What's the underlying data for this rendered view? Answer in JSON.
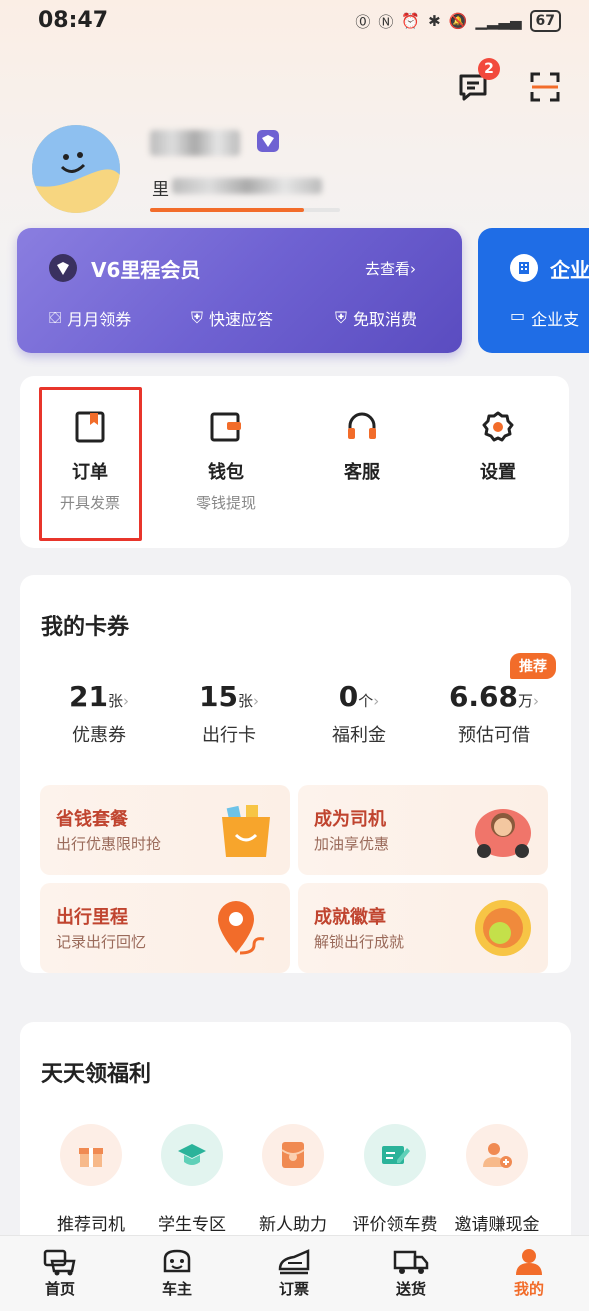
{
  "status_bar": {
    "time": "08:47",
    "battery": "67"
  },
  "header": {
    "message_badge": "2"
  },
  "profile": {
    "mileage_prefix": "里"
  },
  "vip": {
    "title": "V6里程会员",
    "link": "去查看",
    "benefits": [
      "月月领券",
      "快速应答",
      "免取消费"
    ]
  },
  "enterprise": {
    "title": "企业",
    "sub": "企业支"
  },
  "services": [
    {
      "label": "订单",
      "sub": "开具发票"
    },
    {
      "label": "钱包",
      "sub": "零钱提现"
    },
    {
      "label": "客服",
      "sub": ""
    },
    {
      "label": "设置",
      "sub": ""
    }
  ],
  "cards": {
    "title": "我的卡券",
    "recommend_badge": "推荐",
    "items": [
      {
        "value": "21",
        "unit": "张",
        "label": "优惠券"
      },
      {
        "value": "15",
        "unit": "张",
        "label": "出行卡"
      },
      {
        "value": "0",
        "unit": "个",
        "label": "福利金"
      },
      {
        "value": "6.68",
        "unit": "万",
        "label": "预估可借"
      }
    ],
    "tiles": [
      {
        "title": "省钱套餐",
        "sub": "出行优惠限时抢"
      },
      {
        "title": "成为司机",
        "sub": "加油享优惠"
      },
      {
        "title": "出行里程",
        "sub": "记录出行回忆"
      },
      {
        "title": "成就徽章",
        "sub": "解锁出行成就"
      }
    ]
  },
  "welfare": {
    "title": "天天领福利",
    "items": [
      "推荐司机",
      "学生专区",
      "新人助力",
      "评价领车费",
      "邀请赚现金"
    ]
  },
  "tabbar": [
    "首页",
    "车主",
    "订票",
    "送货",
    "我的"
  ],
  "colors": {
    "accent": "#f26c2a",
    "vip": "#6f62d2",
    "enterprise": "#1f6de6",
    "highlight_box": "#e8352b"
  }
}
